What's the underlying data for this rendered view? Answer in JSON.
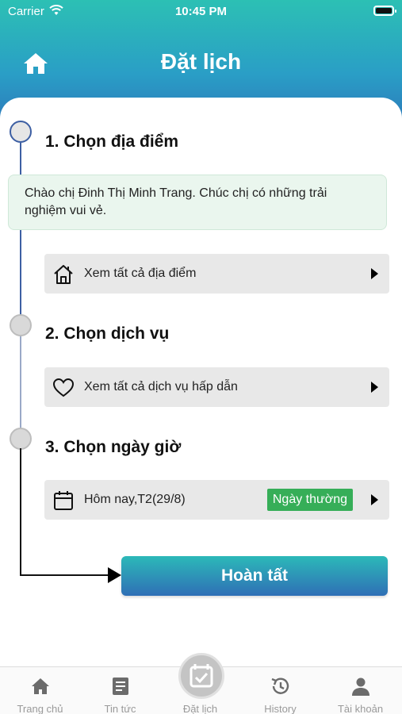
{
  "status_bar": {
    "carrier": "Carrier",
    "time": "10:45 PM"
  },
  "header": {
    "title": "Đặt lịch",
    "home_icon": "home-icon"
  },
  "steps": [
    {
      "title": "1. Chọn địa điểm"
    },
    {
      "title": "2. Chọn dịch vụ"
    },
    {
      "title": "3. Chọn ngày giờ"
    }
  ],
  "greeting": "Chào chị Đinh Thị Minh Trang. Chúc chị có những trải nghiệm vui vẻ.",
  "location_row": {
    "icon": "house-outline-icon",
    "label": "Xem tất cả địa điểm"
  },
  "service_row": {
    "icon": "heart-outline-icon",
    "label": "Xem tất cả dịch vụ hấp dẫn"
  },
  "date_row": {
    "icon": "calendar-icon",
    "label": "Hôm nay,T2(29/8)",
    "badge": "Ngày thường",
    "badge_color": "#36ae58"
  },
  "finish_button": "Hoàn tất",
  "tabs": [
    {
      "label": "Trang chủ",
      "icon": "home-icon"
    },
    {
      "label": "Tin tức",
      "icon": "news-icon"
    },
    {
      "label": "Đặt lịch",
      "icon": "calendar-check-icon",
      "active": true
    },
    {
      "label": "History",
      "icon": "history-icon"
    },
    {
      "label": "Tài khoản",
      "icon": "person-icon"
    }
  ],
  "colors": {
    "header_top": "#2cc0b4",
    "header_bottom": "#2d72b8",
    "timeline_active": "#3d5fa3"
  }
}
